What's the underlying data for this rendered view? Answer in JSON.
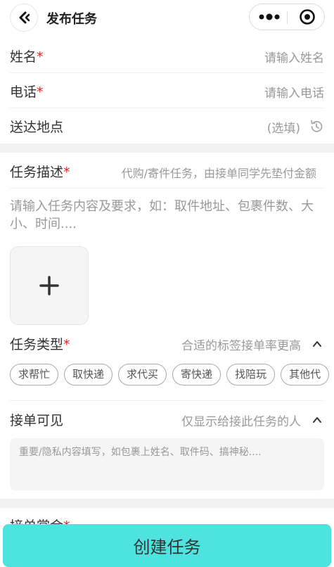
{
  "navbar": {
    "title": "发布任务"
  },
  "basic": {
    "name_label": "姓名",
    "name_placeholder": "请输入姓名",
    "phone_label": "电话",
    "phone_placeholder": "请输入电话",
    "address_label": "送达地点",
    "address_value": "(选填)",
    "required_mark": "*"
  },
  "task": {
    "desc_label": "任务描述",
    "desc_hint": "代购/寄件任务，由接单同学先垫付金额",
    "desc_placeholder": "请输入任务内容及要求，如：取件地址、包裹件数、大小、时间....",
    "type_label": "任务类型",
    "type_hint": "合适的标签接单率更高",
    "tags": [
      "求帮忙",
      "取快递",
      "求代买",
      "寄快递",
      "找陪玩",
      "其他代"
    ],
    "visible_label": "接单可见",
    "visible_hint": "仅显示给接此任务的人",
    "private_placeholder": "重要/隐私内容填写，如包裹上姓名、取件码、搞神秘....",
    "reward_label": "接单赏金"
  },
  "submit": {
    "label": "创建任务"
  },
  "colors": {
    "accent": "#4fe3df",
    "required": "#e02020"
  }
}
